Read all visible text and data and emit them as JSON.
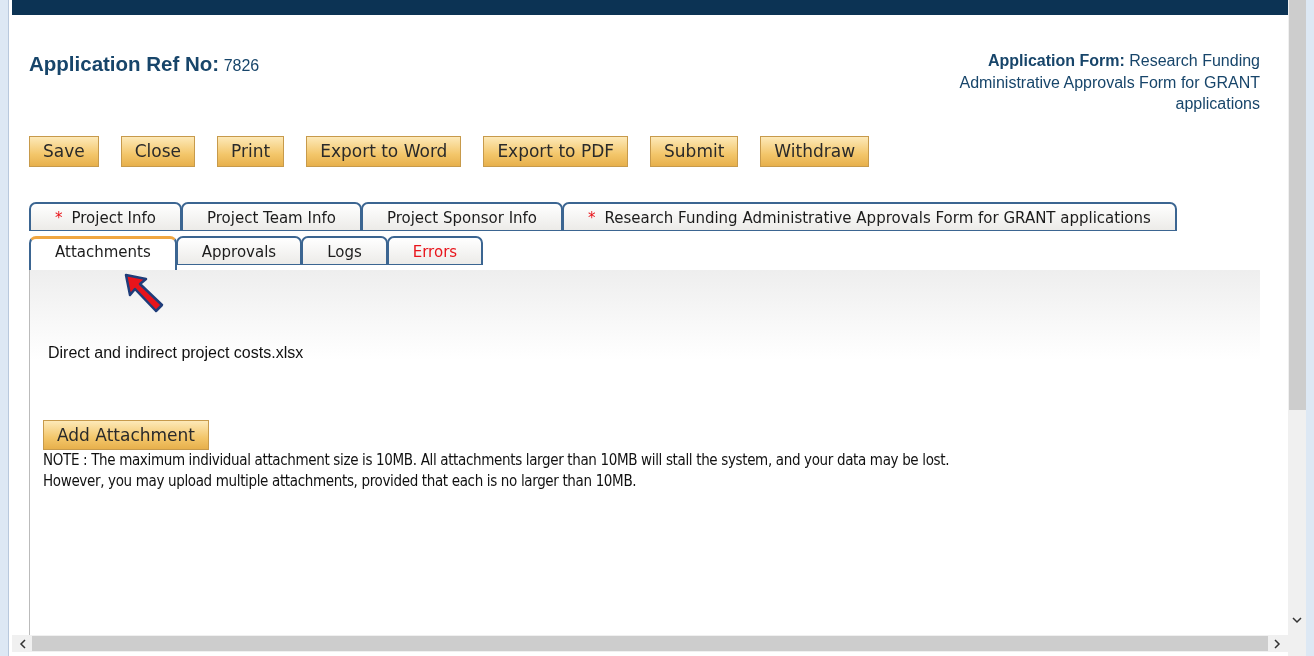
{
  "header": {
    "ref": "**Application Ref No:** 7826",
    "form": "**Application Form:** Research Funding Administrative Approvals Form for GRANT applications"
  },
  "toolbar": [
    "Save",
    "Close",
    "Print",
    "Export to Word",
    "Export to PDF",
    "Submit",
    "Withdraw"
  ],
  "tab_rows": [
    {
      "tabs": [
        {
          "marker": "*",
          "label": "Project Info",
          "selected": false,
          "error": false
        },
        {
          "label": "Project Team Info",
          "selected": false,
          "error": false
        },
        {
          "label": "Project Sponsor Info",
          "selected": false,
          "error": false
        },
        {
          "marker": "*",
          "label": "Research Funding Administrative Approvals Form for GRANT applications",
          "selected": false,
          "error": false
        }
      ]
    },
    {
      "tabs": [
        {
          "label": "Attachments",
          "selected": true,
          "error": false
        },
        {
          "label": "Approvals",
          "selected": false,
          "error": false
        },
        {
          "label": "Logs",
          "selected": false,
          "error": false
        },
        {
          "label": "Errors",
          "selected": false,
          "error": true
        }
      ]
    }
  ],
  "attachments": [
    "Direct and indirect project costs.xlsx"
  ],
  "add_button": "Add Attachment",
  "note": [
    "NOTE : The maximum individual attachment size is 10MB. All attachments larger than 10MB will stall the system, and your data may be lost.",
    "However, you may upload multiple attachments, provided that each is no larger than 10MB."
  ]
}
